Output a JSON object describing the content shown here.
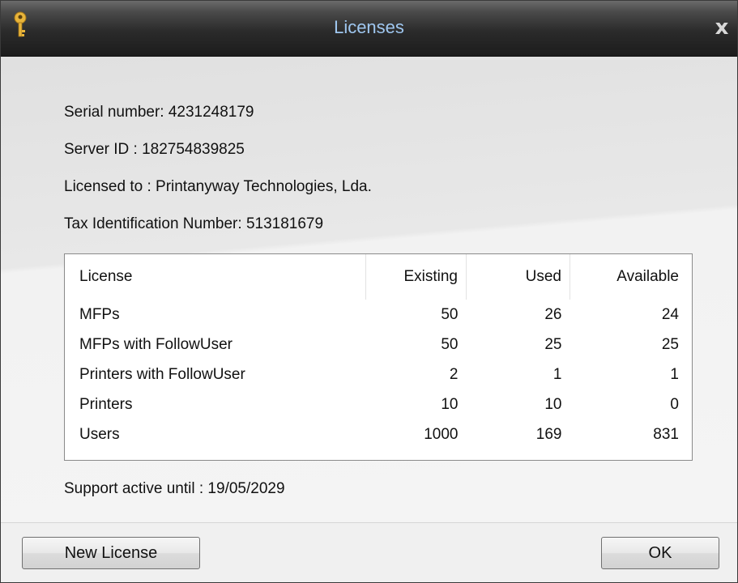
{
  "window": {
    "title": "Licenses",
    "icon": "key-icon",
    "close_label": "x"
  },
  "info": {
    "serial": "Serial number: 4231248179",
    "server_id": "Server ID : 182754839825",
    "licensed_to": "Licensed to : Printanyway Technologies, Lda.",
    "tax_id": "Tax Identification Number: 513181679"
  },
  "table": {
    "headers": [
      "License",
      "Existing",
      "Used",
      "Available"
    ],
    "rows": [
      [
        "MFPs",
        "50",
        "26",
        "24"
      ],
      [
        "MFPs with FollowUser",
        "50",
        "25",
        "25"
      ],
      [
        "Printers with FollowUser",
        "2",
        "1",
        "1"
      ],
      [
        "Printers",
        "10",
        "10",
        "0"
      ],
      [
        "Users",
        "1000",
        "169",
        "831"
      ]
    ]
  },
  "support": "Support active until : 19/05/2029",
  "buttons": {
    "new_license": "New License",
    "ok": "OK"
  },
  "colors": {
    "titlebar": "#2b2b2b",
    "title_text": "#9fc7f0",
    "key_icon": "#e8b43a"
  }
}
